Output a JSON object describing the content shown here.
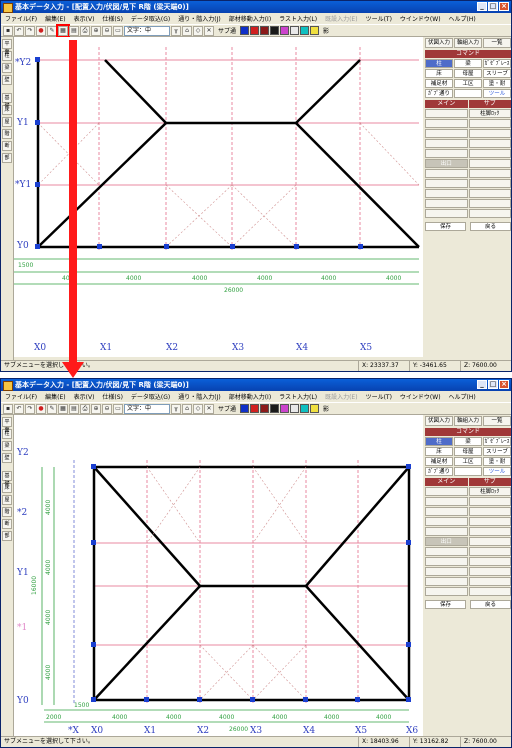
{
  "window": {
    "title": "基本データ入力 - [配置入力/伏図/見下 R階 (梁天端0)]",
    "buttons": {
      "minimize": "_",
      "maximize": "□",
      "close": "×"
    }
  },
  "menu": [
    {
      "label": "ファイル(F)",
      "disabled": false
    },
    {
      "label": "編集(E)",
      "disabled": false
    },
    {
      "label": "表示(V)",
      "disabled": false
    },
    {
      "label": "仕様(S)",
      "disabled": false
    },
    {
      "label": "データ取込(G)",
      "disabled": false
    },
    {
      "label": "通り・階入力(J)",
      "disabled": false
    },
    {
      "label": "部材移動入力(I)",
      "disabled": false
    },
    {
      "label": "ラスト入力(L)",
      "disabled": false
    },
    {
      "label": "既設入力(E)",
      "disabled": true
    },
    {
      "label": "ツール(T)",
      "disabled": false
    },
    {
      "label": "ウインドウ(W)",
      "disabled": false
    },
    {
      "label": "ヘルプ(H)",
      "disabled": false
    }
  ],
  "toolbar": {
    "text_size_select": "文字：中",
    "sub_label": "サブ通",
    "swatch_label": "影",
    "swatches": [
      "#1030c8",
      "#d02020",
      "#8b1a1a",
      "#1a1a1a",
      "#cc44cc",
      "#e8e8e8",
      "#10c0c0",
      "#f0e040",
      "#6060a0",
      "#202060"
    ],
    "icons": [
      "save-icon",
      "undo-icon",
      "redo-icon",
      "stop-icon",
      "grid-icon",
      "pencil-icon",
      "fit-view-icon",
      "print-icon",
      "zoom-in-icon",
      "zoom-window-icon",
      "zoom-out-icon",
      "rect-icon"
    ]
  },
  "left_toolbar": {
    "buttons": [
      "平面",
      "柱",
      "梁",
      "壁",
      "基礎",
      "床",
      "屋",
      "階",
      "断",
      "部",
      "RC",
      "S"
    ]
  },
  "panel": {
    "tabs": [
      "伏図入力",
      "軸組入力",
      "一覧"
    ],
    "command_header": "コマンド",
    "commands": [
      {
        "label": "柱",
        "state": "on"
      },
      {
        "label": "梁",
        "state": ""
      },
      {
        "label": "ｶﾞｾﾞﾌﾞﾚｰｽ",
        "state": ""
      },
      {
        "label": "床",
        "state": ""
      },
      {
        "label": "母屋",
        "state": ""
      },
      {
        "label": "スリーブ",
        "state": ""
      },
      {
        "label": "補足材",
        "state": ""
      },
      {
        "label": "工区",
        "state": ""
      },
      {
        "label": "塗・耐",
        "state": ""
      },
      {
        "label": "ｶﾞﾌﾟ通り",
        "state": ""
      },
      {
        "label": "",
        "state": ""
      },
      {
        "label": "ツール",
        "state": "blue"
      }
    ],
    "main_header": "メイン",
    "sub_header": "サブ",
    "sub_first": "柱脚ﾛｯｸ",
    "main_active": "出口",
    "save_label": "保存",
    "back_label": "戻る"
  },
  "before": {
    "status_message": "サブメニューを選択して下さい。",
    "coords": {
      "x": "X: 23337.37",
      "y": "Y: -3461.65",
      "z": "Z: 7600.00"
    },
    "x_axes": [
      "X0",
      "X1",
      "X2",
      "X3",
      "X4",
      "X5"
    ],
    "y_axes": [
      "Y0",
      "Y1",
      "*Y1",
      "*Y2"
    ],
    "spans": [
      "4000",
      "4000",
      "4000",
      "4000",
      "4000",
      "4000"
    ],
    "offset": "1500",
    "total": "26000"
  },
  "after": {
    "status_message": "サブメニューを選択して下さい。",
    "coords": {
      "x": "X: 18403.96",
      "y": "Y: 13162.82",
      "z": "Z: 7600.00"
    },
    "x_axes": [
      "*X",
      "X0",
      "X1",
      "X2",
      "X3",
      "X4",
      "X5",
      "X6"
    ],
    "y_axes": [
      "Y2",
      "*2",
      "Y1",
      "*1",
      "Y0"
    ],
    "spans": [
      "2000",
      "4000",
      "4000",
      "4000",
      "4000",
      "4000",
      "4000"
    ],
    "offset": "1500",
    "total": "26000",
    "left_dims": [
      "16000",
      "4000",
      "4000",
      "4000",
      "4000"
    ]
  }
}
